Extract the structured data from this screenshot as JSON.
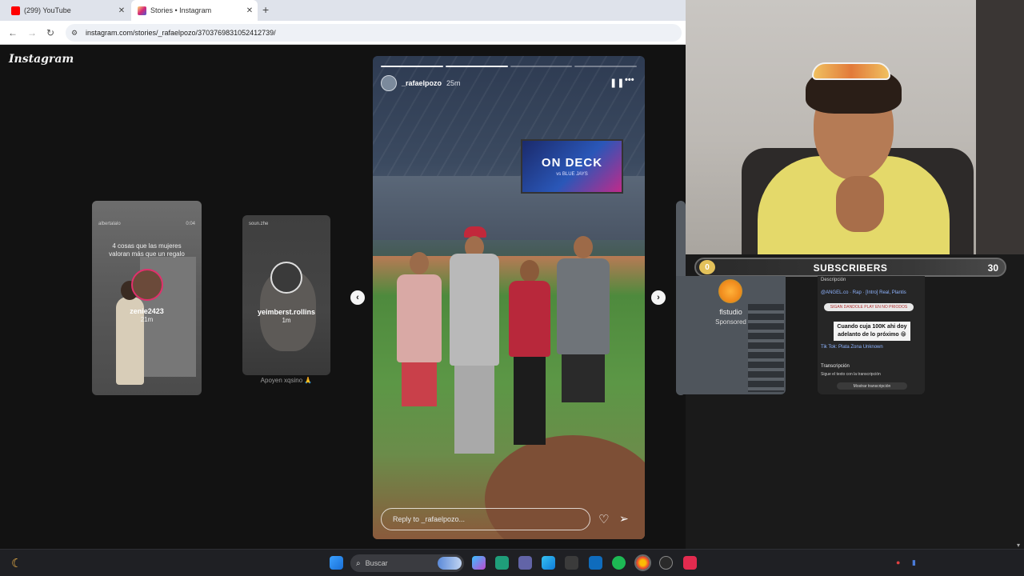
{
  "browser": {
    "tabs": [
      {
        "title": "(299) YouTube",
        "icon": "youtube-icon",
        "color": "#ff0000"
      },
      {
        "title": "Stories • Instagram",
        "icon": "instagram-icon",
        "color": "#d6249f"
      }
    ],
    "url": "instagram.com/stories/_rafaelpozo/3703769831052412739/"
  },
  "instagram": {
    "logo": "Instagram",
    "side_stories": [
      {
        "user": "zenie2423",
        "time": "21m",
        "top_left": "albertalalo",
        "top_right": "0:04",
        "caption": "4 cosas que las mujeres valoran más que un regalo"
      },
      {
        "user": "yeimberst.rollins",
        "time": "1m",
        "top_left": "soun.zhe",
        "top_right": "",
        "caption": "Apoyen xqsino 🙏"
      }
    ],
    "story": {
      "user": "_rafaelpozo",
      "time": "25m",
      "scoreboard_title": "ON DECK",
      "scoreboard_sub": "vs BLUE JAYS",
      "progress": {
        "total": 4,
        "done": 2
      },
      "reply_placeholder": "Reply to _rafaelpozo..."
    },
    "right_stories": [
      {
        "name": "flstudio",
        "label": "Sponsored"
      }
    ],
    "right_story2": {
      "header": "Descripción",
      "line1": "@ANGEL.co · Rap · [Intro] Real, Plantis",
      "chip": "SIGAN DANDOLE PLAY EN NO PRIODOS",
      "note_line1": "Cuando cuja 100K ahi doy",
      "note_line2": "adelanto de lo próximo 😁",
      "line2": "Tik Tok: Plata Zona Unknown",
      "transcript": "Transcripción",
      "transcript_sub": "Sigue el texto con la transcripción",
      "button": "Mostrar transcripción"
    }
  },
  "overlay": {
    "subscribers_label": "SUBSCRIBERS",
    "start": "0",
    "goal": "30"
  },
  "taskbar": {
    "search_placeholder": "Buscar"
  }
}
